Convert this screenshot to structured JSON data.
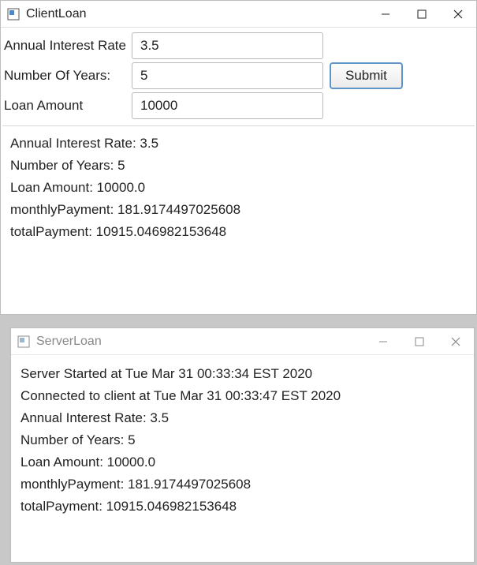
{
  "client": {
    "title": "ClientLoan",
    "labels": {
      "rate": "Annual Interest Rate",
      "years": "Number Of Years:",
      "amount": "Loan Amount",
      "submit": "Submit"
    },
    "inputs": {
      "rate": "3.5",
      "years": "5",
      "amount": "10000"
    },
    "output": "Annual Interest Rate: 3.5\nNumber of Years: 5\nLoan Amount: 10000.0\nmonthlyPayment: 181.9174497025608\ntotalPayment: 10915.046982153648"
  },
  "server": {
    "title": "ServerLoan",
    "output": "Server Started at Tue Mar 31 00:33:34 EST 2020\nConnected to client at Tue Mar 31 00:33:47 EST 2020\nAnnual Interest Rate: 3.5\nNumber of Years: 5\nLoan Amount: 10000.0\nmonthlyPayment: 181.9174497025608\ntotalPayment: 10915.046982153648"
  }
}
